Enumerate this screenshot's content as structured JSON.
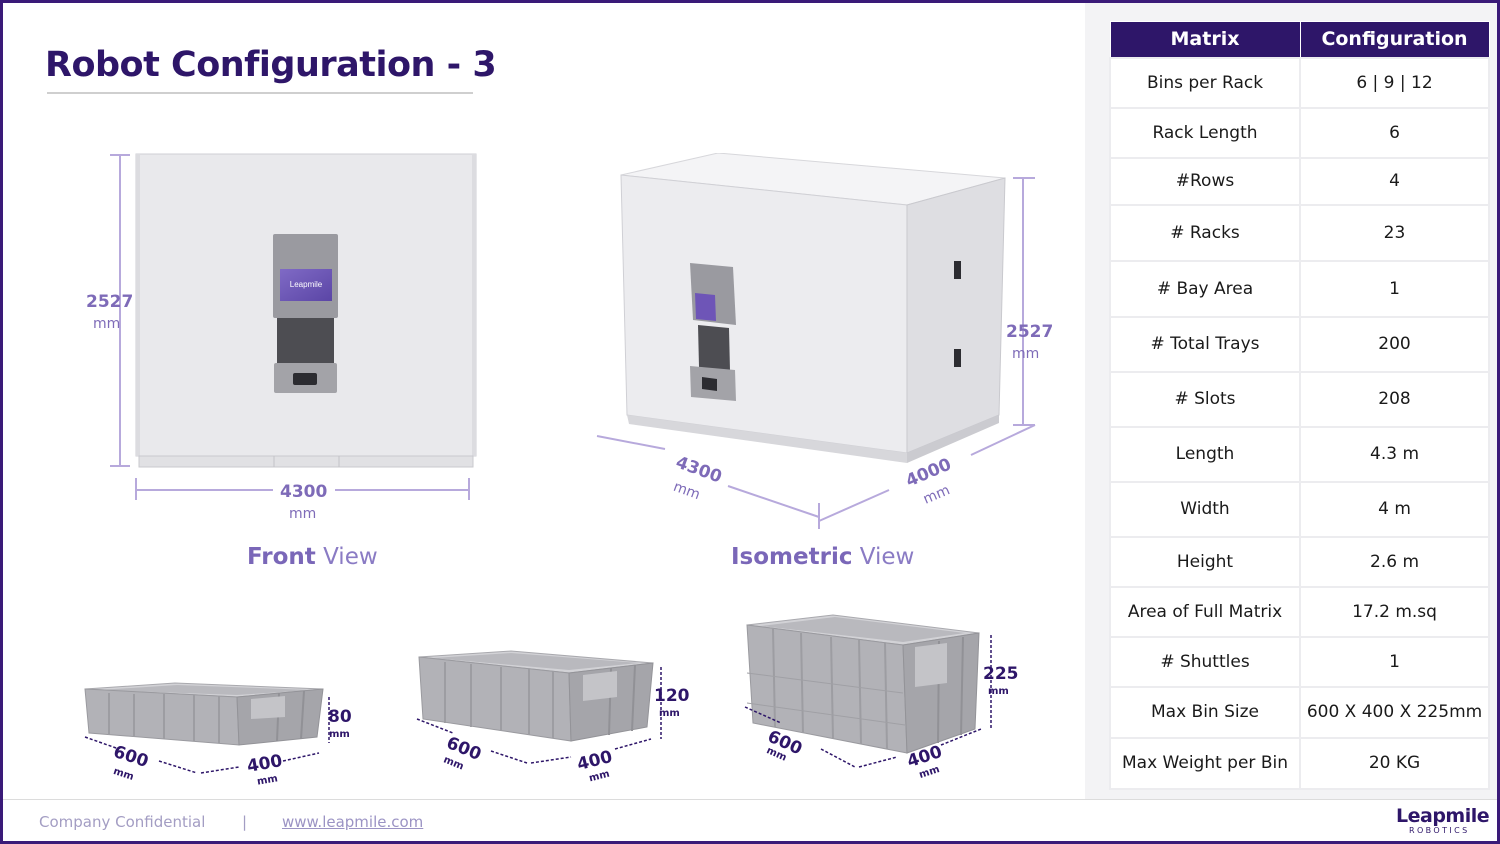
{
  "title": "Robot Configuration - 3",
  "front_view": {
    "height": "2527",
    "width": "4300",
    "unit": "mm",
    "caption_bold": "Front",
    "caption_rest": "View"
  },
  "isometric_view": {
    "height": "2527",
    "length": "4300",
    "width": "4000",
    "unit": "mm",
    "caption_bold": "Isometric",
    "caption_rest": "View"
  },
  "bins": [
    {
      "length": "600",
      "width": "400",
      "height": "80",
      "unit": "mm"
    },
    {
      "length": "600",
      "width": "400",
      "height": "120",
      "unit": "mm"
    },
    {
      "length": "600",
      "width": "400",
      "height": "225",
      "unit": "mm"
    }
  ],
  "table": {
    "headers": [
      "Matrix",
      "Configuration"
    ],
    "rows": [
      [
        "Bins per Rack",
        "6 | 9 | 12"
      ],
      [
        "Rack Length",
        "6"
      ],
      [
        "#Rows",
        "4"
      ],
      [
        "# Racks",
        "23"
      ],
      [
        "# Bay Area",
        "1"
      ],
      [
        "# Total Trays",
        "200"
      ],
      [
        "# Slots",
        "208"
      ],
      [
        "Length",
        "4.3 m"
      ],
      [
        "Width",
        "4 m"
      ],
      [
        "Height",
        "2.6 m"
      ],
      [
        "Area of Full Matrix",
        "17.2 m.sq"
      ],
      [
        "# Shuttles",
        "1"
      ],
      [
        "Max Bin Size",
        "600 X 400 X 225mm"
      ],
      [
        "Max Weight per Bin",
        "20 KG"
      ]
    ]
  },
  "footer": {
    "confidential": "Company Confidential",
    "separator": "|",
    "website": "www.leapmile.com",
    "logo_word": "Leapmile",
    "logo_sub": "ROBOTICS"
  },
  "colors": {
    "brand_primary": "#2e1669",
    "dimension_accent": "#7e6bb8",
    "panel_background": "#f3f3f5"
  }
}
